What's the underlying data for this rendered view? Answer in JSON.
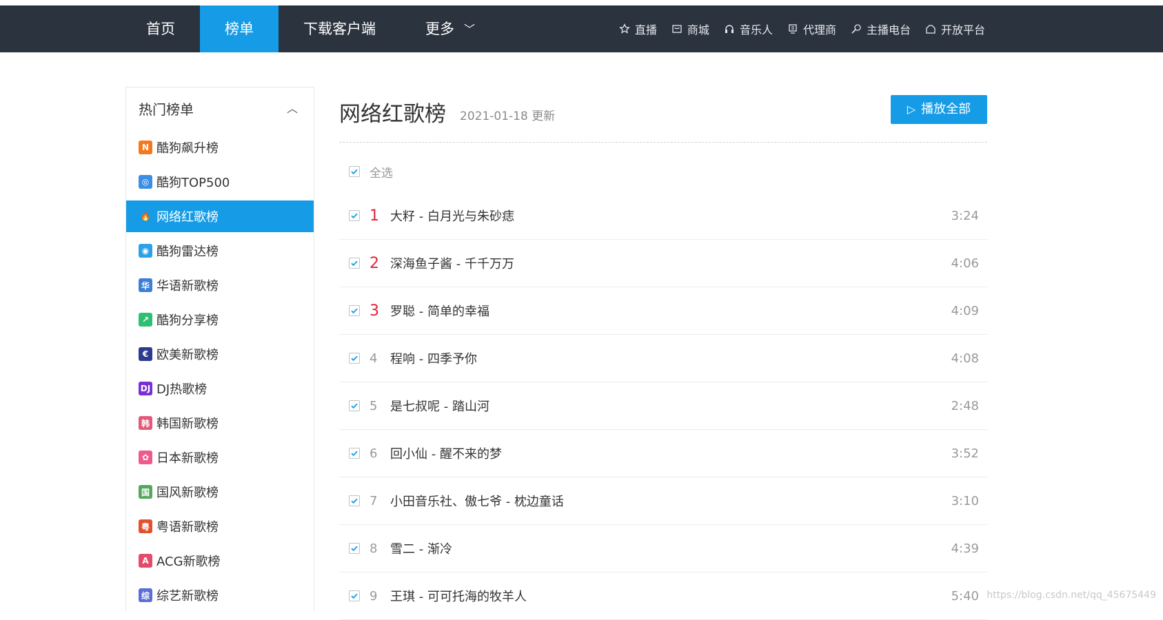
{
  "nav": {
    "main": [
      {
        "label": "首页",
        "active": false
      },
      {
        "label": "榜单",
        "active": true
      },
      {
        "label": "下载客户端",
        "active": false
      },
      {
        "label": "更多",
        "active": false
      }
    ],
    "right": [
      {
        "label": "直播",
        "icon": "star-icon"
      },
      {
        "label": "商城",
        "icon": "shop-icon"
      },
      {
        "label": "音乐人",
        "icon": "headphones-icon"
      },
      {
        "label": "代理商",
        "icon": "agent-icon"
      },
      {
        "label": "主播电台",
        "icon": "radio-icon"
      },
      {
        "label": "开放平台",
        "icon": "platform-icon"
      }
    ]
  },
  "sidebar": {
    "title": "热门榜单",
    "items": [
      {
        "label": "酷狗飙升榜",
        "icon_text": "N",
        "icon_color": "#f5781f"
      },
      {
        "label": "酷狗TOP500",
        "icon_text": "◎",
        "icon_color": "#3a8ee6"
      },
      {
        "label": "网络红歌榜",
        "icon_text": "🔥",
        "icon_color": "#e8432f",
        "active": true
      },
      {
        "label": "酷狗雷达榜",
        "icon_text": "◉",
        "icon_color": "#2aa1e8"
      },
      {
        "label": "华语新歌榜",
        "icon_text": "华",
        "icon_color": "#3d7fd6"
      },
      {
        "label": "酷狗分享榜",
        "icon_text": "↗",
        "icon_color": "#2fbf71"
      },
      {
        "label": "欧美新歌榜",
        "icon_text": "€",
        "icon_color": "#2c3b8f"
      },
      {
        "label": "DJ热歌榜",
        "icon_text": "DJ",
        "icon_color": "#7a2fd6"
      },
      {
        "label": "韩国新歌榜",
        "icon_text": "韩",
        "icon_color": "#e25a7a"
      },
      {
        "label": "日本新歌榜",
        "icon_text": "✿",
        "icon_color": "#ef5a8c"
      },
      {
        "label": "国风新歌榜",
        "icon_text": "国",
        "icon_color": "#53a95b"
      },
      {
        "label": "粤语新歌榜",
        "icon_text": "粤",
        "icon_color": "#e2512d"
      },
      {
        "label": "ACG新歌榜",
        "icon_text": "A",
        "icon_color": "#e44a6a"
      },
      {
        "label": "综艺新歌榜",
        "icon_text": "综",
        "icon_color": "#5a6fd6"
      }
    ]
  },
  "main": {
    "title": "网络红歌榜",
    "date": "2021-01-18 更新",
    "play_all": "播放全部",
    "select_all": "全选",
    "songs": [
      {
        "rank": "1",
        "name": "大籽 - 白月光与朱砂痣",
        "time": "3:24"
      },
      {
        "rank": "2",
        "name": "深海鱼子酱 - 千千万万",
        "time": "4:06"
      },
      {
        "rank": "3",
        "name": "罗聪 - 简单的幸福",
        "time": "4:09"
      },
      {
        "rank": "4",
        "name": "程响 - 四季予你",
        "time": "4:08"
      },
      {
        "rank": "5",
        "name": "是七叔呢 - 踏山河",
        "time": "2:48"
      },
      {
        "rank": "6",
        "name": "回小仙 - 醒不来的梦",
        "time": "3:52"
      },
      {
        "rank": "7",
        "name": "小田音乐社、傲七爷 - 枕边童话",
        "time": "3:10"
      },
      {
        "rank": "8",
        "name": "雪二 - 渐冷",
        "time": "4:39"
      },
      {
        "rank": "9",
        "name": "王琪 - 可可托海的牧羊人",
        "time": "5:40"
      }
    ]
  },
  "watermark": "https://blog.csdn.net/qq_45675449",
  "colors": {
    "accent": "#169ce6",
    "topbar": "#2b333e",
    "rank_top": "#e3203b"
  }
}
